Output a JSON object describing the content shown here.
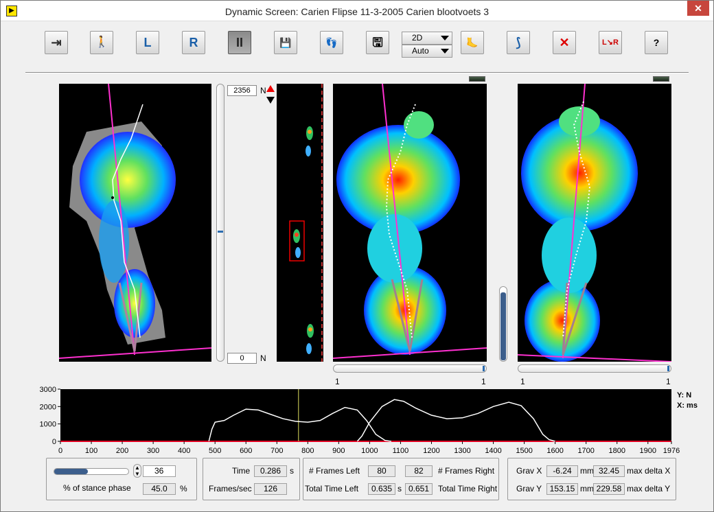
{
  "window": {
    "title": "Dynamic Screen: Carien Flipse 11-3-2005 Carien blootvoets 3",
    "close": "✕"
  },
  "toolbar": {
    "exit": "⇥",
    "walk": "🚶",
    "left": "L",
    "right": "R",
    "pause": "II",
    "save_disabled": "💾",
    "footprints": "👣",
    "disk": "🖫",
    "foot_color": "🦶",
    "foot_side": "⟆",
    "delete": "✕",
    "left_right": "L↘R",
    "help": "?"
  },
  "view_mode": {
    "dim": "2D",
    "scale": "Auto"
  },
  "force_scale": {
    "max": "2356",
    "min": "0",
    "unit": "N"
  },
  "chart_data": {
    "type": "line",
    "xlim": [
      0,
      1976
    ],
    "ylim": [
      0,
      3000
    ],
    "xticks": [
      "0",
      "100",
      "200",
      "300",
      "400",
      "500",
      "600",
      "700",
      "800",
      "900",
      "1000",
      "1100",
      "1200",
      "1300",
      "1400",
      "1500",
      "1600",
      "1700",
      "1800",
      "1900",
      "1976"
    ],
    "yticks": [
      "3000",
      "2000",
      "1000",
      "0"
    ],
    "axis_units": {
      "y": "Y: N",
      "x": "X: ms"
    },
    "cursor_x": 770,
    "series": [
      {
        "values": [
          [
            480,
            0
          ],
          [
            490,
            700
          ],
          [
            500,
            1100
          ],
          [
            530,
            1200
          ],
          [
            560,
            1500
          ],
          [
            600,
            1850
          ],
          [
            640,
            1800
          ],
          [
            680,
            1550
          ],
          [
            720,
            1300
          ],
          [
            760,
            1150
          ],
          [
            800,
            1100
          ],
          [
            840,
            1200
          ],
          [
            880,
            1600
          ],
          [
            920,
            1950
          ],
          [
            960,
            1800
          ],
          [
            990,
            1200
          ],
          [
            1020,
            400
          ],
          [
            1050,
            50
          ],
          [
            1070,
            0
          ]
        ]
      },
      {
        "values": [
          [
            960,
            0
          ],
          [
            975,
            300
          ],
          [
            1000,
            1100
          ],
          [
            1040,
            2000
          ],
          [
            1080,
            2400
          ],
          [
            1110,
            2300
          ],
          [
            1150,
            1900
          ],
          [
            1200,
            1500
          ],
          [
            1250,
            1300
          ],
          [
            1300,
            1350
          ],
          [
            1350,
            1600
          ],
          [
            1400,
            2000
          ],
          [
            1450,
            2250
          ],
          [
            1490,
            2050
          ],
          [
            1530,
            1300
          ],
          [
            1560,
            400
          ],
          [
            1580,
            100
          ],
          [
            1600,
            0
          ]
        ]
      }
    ]
  },
  "stance": {
    "value": "36",
    "percent": "45.0",
    "label": "% of stance phase",
    "unit": "%",
    "fill": 0.45
  },
  "time": {
    "label": "Time",
    "value": "0.286",
    "unit": "s",
    "fps_label": "Frames/sec",
    "fps": "126"
  },
  "frames": {
    "left_label": "# Frames Left",
    "left": "80",
    "right": "82",
    "right_label": "# Frames Right",
    "tl_label": "Total Time Left",
    "tl": "0.635",
    "s": "s",
    "tr": "0.651",
    "tr_label": "Total Time Right"
  },
  "grav": {
    "x_label": "Grav X",
    "x": "-6.24",
    "mm": "mm",
    "dx": "32.45",
    "dx_label": "max delta X",
    "y_label": "Grav Y",
    "y": "153.15",
    "dy": "229.58",
    "dy_label": "max delta Y"
  },
  "slider_labels": {
    "a1": "1",
    "a2": "1",
    "b1": "1",
    "b2": "1"
  }
}
